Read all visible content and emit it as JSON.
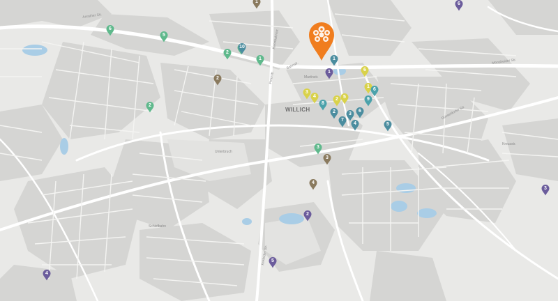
{
  "map": {
    "town_label": "WILLICH",
    "streets": [
      {
        "text": "Moosheider Str.",
        "cls": "street e"
      },
      {
        "text": "Anrather Str.",
        "cls": "street e"
      },
      {
        "text": "Bahnstr.",
        "cls": "street d"
      },
      {
        "text": "Peterstr.",
        "cls": "street v"
      },
      {
        "text": "Krefelder Str.",
        "cls": "street v"
      },
      {
        "text": "Schiefbahn",
        "cls": "street"
      },
      {
        "text": "Düsseldorfer Str.",
        "cls": "street d"
      },
      {
        "text": "Unterbruch",
        "cls": "street"
      },
      {
        "text": "Martinstr.",
        "cls": "street"
      },
      {
        "text": "Kreuzstr.",
        "cls": "street"
      },
      {
        "text": "Rennbahnstr.",
        "cls": "street v"
      }
    ],
    "pins": [
      {
        "label": "1",
        "color": "#8a7a5e"
      },
      {
        "label": "6",
        "color": "#6b5c9c"
      },
      {
        "label": "6",
        "color": "#5fb98c"
      },
      {
        "label": "5",
        "color": "#5fb98c"
      },
      {
        "label": "2",
        "color": "#5fb98c"
      },
      {
        "label": "1",
        "color": "#5fb98c"
      },
      {
        "label": "10",
        "color": "#4b8d9f"
      },
      {
        "label": "1",
        "color": "#5fb98c"
      },
      {
        "label": "1",
        "color": "#4b8d9f"
      },
      {
        "label": "1",
        "color": "#6b5c9c"
      },
      {
        "label": "2",
        "color": "#8a7a5e"
      },
      {
        "label": "2",
        "color": "#5fb98c"
      },
      {
        "label": "3",
        "color": "#d9d24a"
      },
      {
        "label": "4",
        "color": "#d9d24a"
      },
      {
        "label": "2",
        "color": "#d9d24a"
      },
      {
        "label": "5",
        "color": "#d9d24a"
      },
      {
        "label": "6",
        "color": "#d9d24a"
      },
      {
        "label": "1",
        "color": "#d9d24a"
      },
      {
        "label": "6",
        "color": "#4ba2ab"
      },
      {
        "label": "9",
        "color": "#4ba2ab"
      },
      {
        "label": "8",
        "color": "#4ba2ab"
      },
      {
        "label": "2",
        "color": "#4b8d9f"
      },
      {
        "label": "3",
        "color": "#4b8d9f"
      },
      {
        "label": "6",
        "color": "#4b8d9f"
      },
      {
        "label": "7",
        "color": "#4b8d9f"
      },
      {
        "label": "4",
        "color": "#4b8d9f"
      },
      {
        "label": "5",
        "color": "#4b8d9f"
      },
      {
        "label": "3",
        "color": "#5fb98c"
      },
      {
        "label": "3",
        "color": "#8a7a5e"
      },
      {
        "label": "4",
        "color": "#8a7a5e"
      },
      {
        "label": "2",
        "color": "#6b5c9c"
      },
      {
        "label": "5",
        "color": "#6b5c9c"
      },
      {
        "label": "4",
        "color": "#6b5c9c"
      },
      {
        "label": "3",
        "color": "#6b5c9c"
      },
      {
        "label": "7",
        "color": "#6b5c9c"
      }
    ],
    "main_pin_color": "#f07d1e",
    "map_colors": {
      "land": "#e9e9e7",
      "block": "#d5d5d3",
      "road": "#ffffff",
      "water": "#a9cde6"
    }
  }
}
